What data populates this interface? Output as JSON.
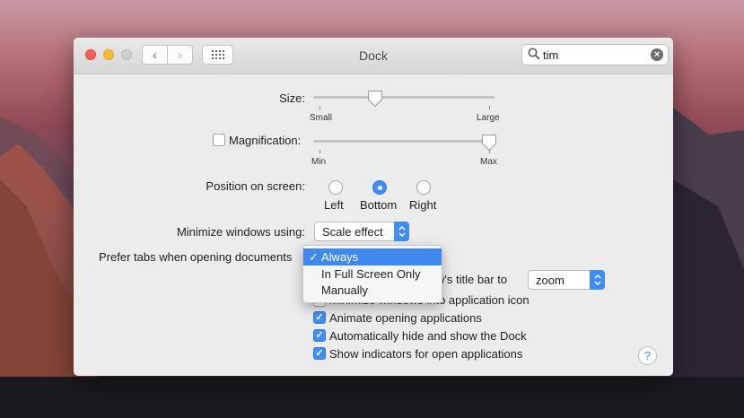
{
  "window": {
    "title": "Dock"
  },
  "search": {
    "value": "tim"
  },
  "size": {
    "label": "Size:",
    "min_label": "Small",
    "max_label": "Large",
    "value_fraction": 0.34
  },
  "magnification": {
    "label": "Magnification:",
    "checked": false,
    "min_label": "Min",
    "max_label": "Max",
    "value_fraction": 0.97
  },
  "position": {
    "label": "Position on screen:",
    "options": [
      "Left",
      "Bottom",
      "Right"
    ],
    "selected": "Bottom"
  },
  "minimize": {
    "label": "Minimize windows using:",
    "value": "Scale effect"
  },
  "prefer_tabs": {
    "label": "Prefer tabs when opening documents",
    "menu": [
      "Always",
      "In Full Screen Only",
      "Manually"
    ],
    "selected": "Always",
    "check_glyph": "✓"
  },
  "double_click": {
    "label_visible": "w's title bar to",
    "value": "zoom"
  },
  "minimize_into": {
    "label_visible": "Minimize windows into application icon",
    "checked": false
  },
  "animate": {
    "label": "Animate opening applications",
    "checked": true
  },
  "autohide": {
    "label": "Automatically hide and show the Dock",
    "checked": true
  },
  "indicators": {
    "label": "Show indicators for open applications",
    "checked": true
  },
  "help": {
    "label": "?"
  },
  "glyphs": {
    "check": "✓",
    "back": "‹",
    "forward": "›",
    "clear": "×"
  }
}
